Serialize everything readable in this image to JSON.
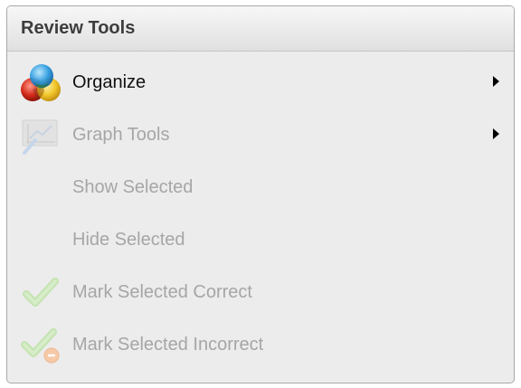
{
  "panel": {
    "title": "Review Tools"
  },
  "menu": {
    "items": [
      {
        "label": "Organize",
        "icon": "organize-icon",
        "enabled": true,
        "submenu": true
      },
      {
        "label": "Graph Tools",
        "icon": "graph-tools-icon",
        "enabled": false,
        "submenu": true
      },
      {
        "label": "Show Selected",
        "icon": "",
        "enabled": false,
        "submenu": false
      },
      {
        "label": "Hide Selected",
        "icon": "",
        "enabled": false,
        "submenu": false
      },
      {
        "label": "Mark Selected Correct",
        "icon": "checkmark-icon",
        "enabled": false,
        "submenu": false
      },
      {
        "label": "Mark Selected Incorrect",
        "icon": "checkmark-incorrect-icon",
        "enabled": false,
        "submenu": false
      }
    ]
  },
  "colors": {
    "enabled_text": "#111111",
    "disabled_text": "#a6a6a6",
    "panel_background": "#ececec"
  }
}
